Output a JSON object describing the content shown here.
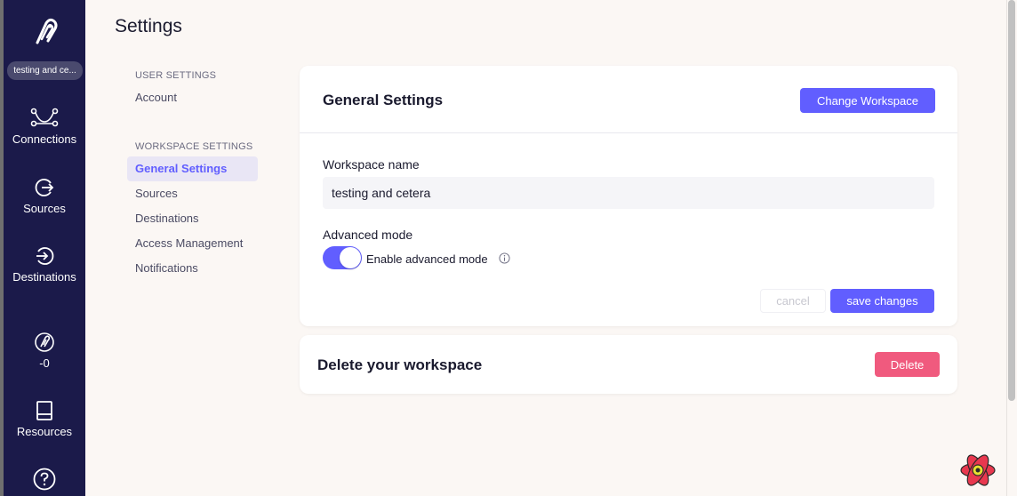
{
  "sidebar": {
    "workspace_pill": "testing and ce...",
    "nav": [
      {
        "label": "Connections",
        "icon": "connections-icon"
      },
      {
        "label": "Sources",
        "icon": "sources-icon"
      },
      {
        "label": "Destinations",
        "icon": "destinations-icon"
      },
      {
        "label": "-0",
        "icon": "credits-icon"
      },
      {
        "label": "Resources",
        "icon": "book-icon"
      },
      {
        "label": "",
        "icon": "help-icon"
      }
    ]
  },
  "page": {
    "title": "Settings"
  },
  "settings_nav": {
    "user_section": "USER SETTINGS",
    "user_items": [
      "Account"
    ],
    "workspace_section": "WORKSPACE SETTINGS",
    "workspace_items": [
      "General Settings",
      "Sources",
      "Destinations",
      "Access Management",
      "Notifications"
    ],
    "active_item": "General Settings"
  },
  "general": {
    "title": "General Settings",
    "change_workspace_label": "Change Workspace",
    "workspace_name_label": "Workspace name",
    "workspace_name_value": "testing and cetera",
    "advanced_mode_label": "Advanced mode",
    "advanced_toggle_label": "Enable advanced mode",
    "advanced_enabled": true,
    "cancel_label": "cancel",
    "save_label": "save changes"
  },
  "delete": {
    "title": "Delete your workspace",
    "button_label": "Delete"
  },
  "colors": {
    "sidebar_bg": "#1b1a4a",
    "primary": "#615eff",
    "danger": "#f05a7e",
    "page_bg": "#fbf7f4"
  }
}
